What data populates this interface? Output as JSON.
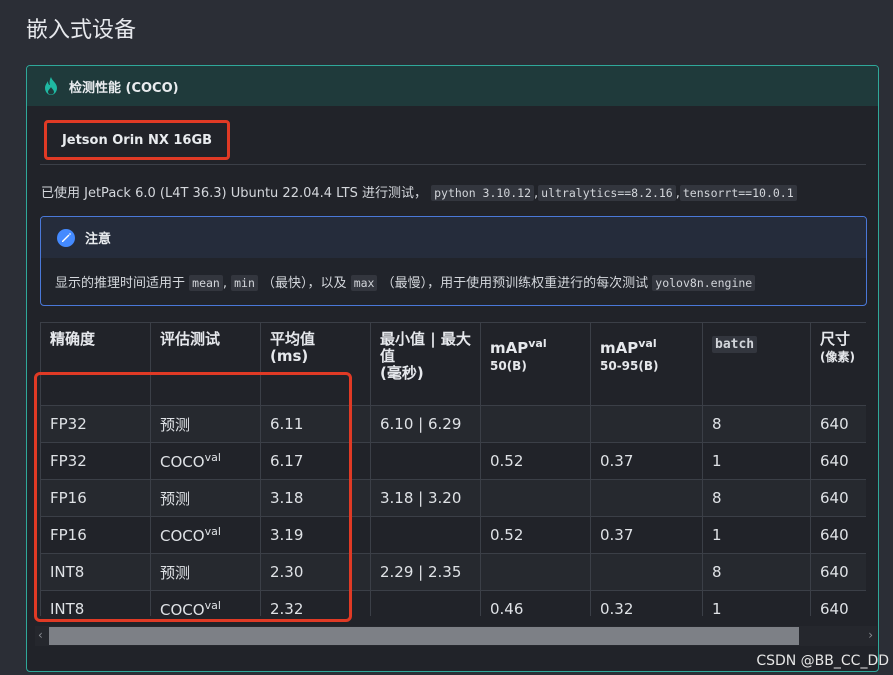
{
  "page": {
    "title": "嵌入式设备"
  },
  "card": {
    "title": "检测性能 (COCO)",
    "icon": "flame-icon"
  },
  "tab": {
    "label": "Jetson Orin NX 16GB"
  },
  "description": {
    "text": "已使用 JetPack 6.0 (L4T 36.3) Ubuntu 22.04.4 LTS 进行测试，",
    "code1": "python 3.10.12",
    "sep": ",",
    "code2": "ultralytics==8.2.16",
    "code3": "tensorrt==10.0.1"
  },
  "note": {
    "title": "注意",
    "icon": "pencil-icon",
    "text1": "显示的推理时间适用于",
    "code_mean": "mean",
    "code_min": "min",
    "text2": "（最快），以及",
    "code_max": "max",
    "text3": "（最慢），用于使用预训练权重进行的每次测试",
    "code_engine": "yolov8n.engine"
  },
  "table": {
    "headers": {
      "precision": "精确度",
      "eval": "评估测试",
      "mean": "平均值",
      "mean_unit": "(ms)",
      "minmax": "最小值 | 最大值",
      "minmax_unit": "(毫秒)",
      "map50_main": "mAP",
      "map50_sup": "val",
      "map50_sub": "50(B)",
      "map5095_main": "mAP",
      "map5095_sup": "val",
      "map5095_sub": "50-95(B)",
      "batch": "batch",
      "size": "尺寸",
      "size_unit": "(像素)"
    },
    "eval_coco": "COCO",
    "eval_coco_sup": "val",
    "rows": [
      {
        "precision": "FP32",
        "eval": "预测",
        "mean": "6.11",
        "minmax": "6.10 | 6.29",
        "map50": "",
        "map5095": "",
        "batch": "8",
        "size": "640"
      },
      {
        "precision": "FP32",
        "eval": "COCO",
        "mean": "6.17",
        "minmax": "",
        "map50": "0.52",
        "map5095": "0.37",
        "batch": "1",
        "size": "640"
      },
      {
        "precision": "FP16",
        "eval": "预测",
        "mean": "3.18",
        "minmax": "3.18 | 3.20",
        "map50": "",
        "map5095": "",
        "batch": "8",
        "size": "640"
      },
      {
        "precision": "FP16",
        "eval": "COCO",
        "mean": "3.19",
        "minmax": "",
        "map50": "0.52",
        "map5095": "0.37",
        "batch": "1",
        "size": "640"
      },
      {
        "precision": "INT8",
        "eval": "预测",
        "mean": "2.30",
        "minmax": "2.29 | 2.35",
        "map50": "",
        "map5095": "",
        "batch": "8",
        "size": "640"
      },
      {
        "precision": "INT8",
        "eval": "COCO",
        "mean": "2.32",
        "minmax": "",
        "map50": "0.46",
        "map5095": "0.32",
        "batch": "1",
        "size": "640"
      }
    ]
  },
  "scrollbar": {
    "left": "‹",
    "right": "›"
  },
  "watermark": "CSDN @BB_CC_DD",
  "colors": {
    "accent": "#2fa89a",
    "highlight": "#e03a25",
    "note": "#4a78d8"
  }
}
